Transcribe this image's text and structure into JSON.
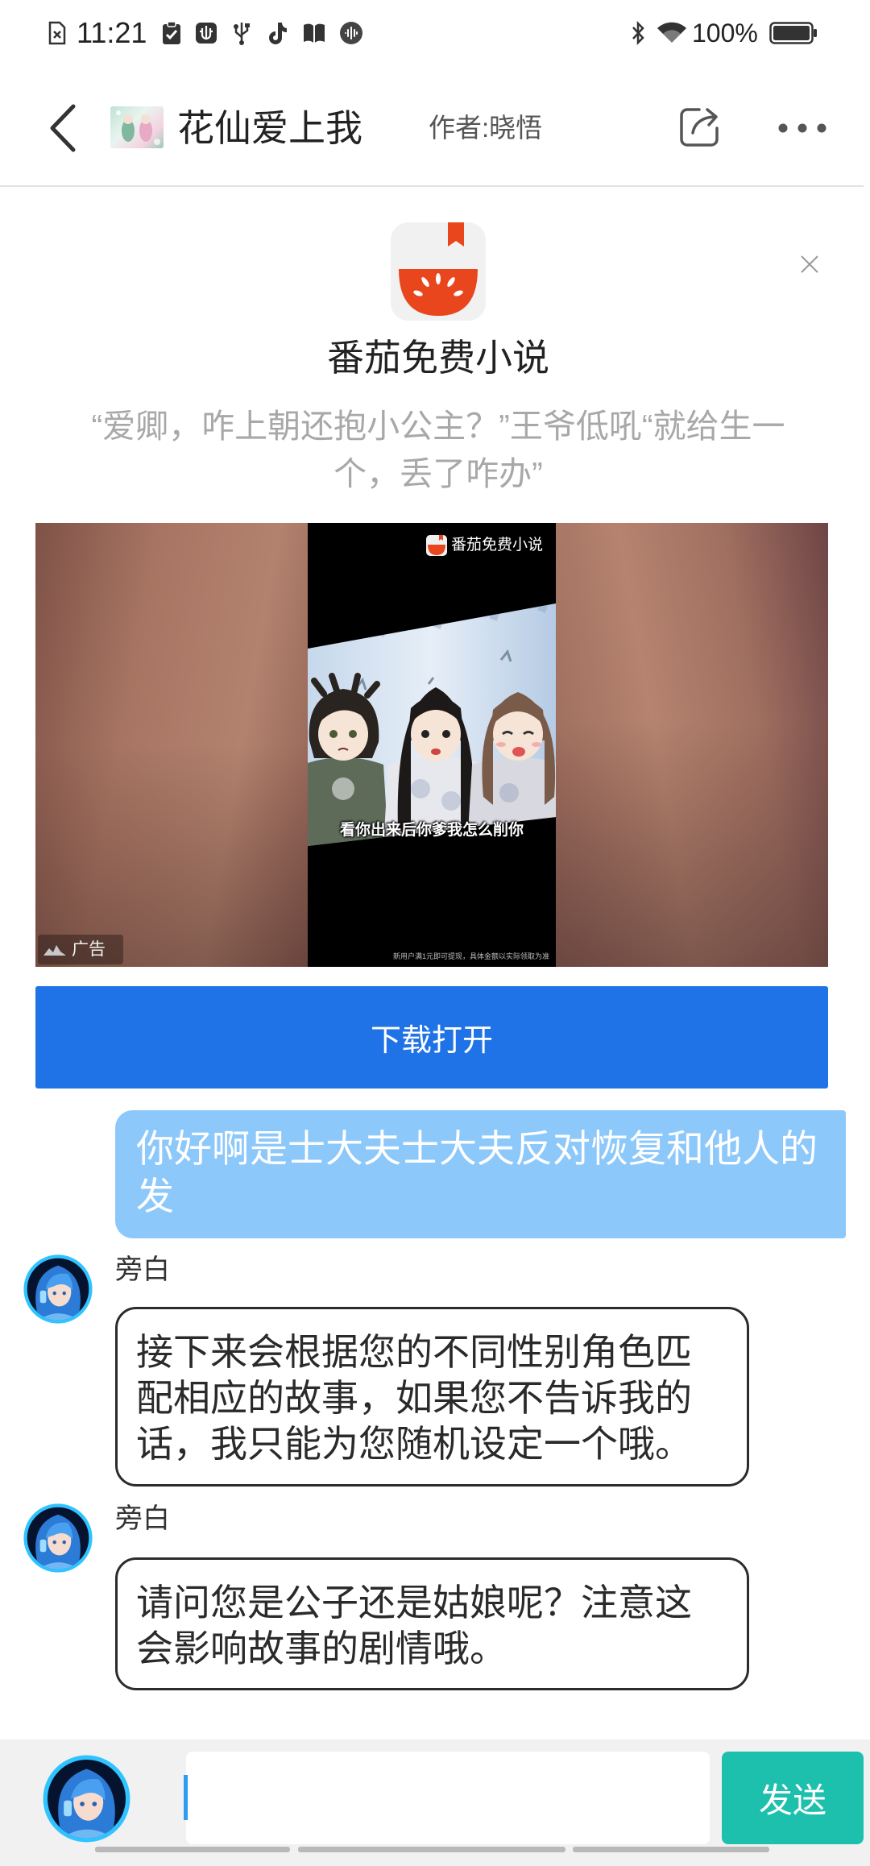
{
  "status_bar": {
    "time": "11:21",
    "battery": "100%",
    "left_icons": [
      "document-icon",
      "clipboard-check-icon",
      "usb-debugging-icon",
      "usb-icon",
      "tiktok-icon",
      "book-icon",
      "voice-assistant-icon"
    ],
    "right_icons": [
      "bluetooth-icon",
      "wifi-icon",
      "battery-icon"
    ]
  },
  "header": {
    "title": "花仙爱上我",
    "author": "作者:晓悟",
    "icons": [
      "back-icon",
      "share-icon",
      "more-icon"
    ]
  },
  "ad": {
    "app_name": "番茄免费小说",
    "quote_lines": [
      "“爱卿，咋上朝还抱小公主？”王爷低吼“就给生一",
      "个，丢了咋办”"
    ],
    "video": {
      "logo_text": "番茄免费小说",
      "caption": "看你出来后你爹我怎么削你",
      "disclaimer": "新用户满1元即可提现，具体金额以实际领取为准"
    },
    "tag": "广告",
    "download_label": "下载打开"
  },
  "messages": [
    {
      "role": "user",
      "lines": [
        "你好啊是士大夫士大夫反对恢复和他人的",
        "发"
      ]
    },
    {
      "role": "narrator",
      "name": "旁白",
      "lines": [
        "接下来会根据您的不同性别角色匹",
        "配相应的故事，如果您不告诉我的",
        "话，我只能为您随机设定一个哦。"
      ]
    },
    {
      "role": "narrator",
      "name": "旁白",
      "lines": [
        "请问您是公子还是姑娘呢？注意这",
        "会影响故事的剧情哦。"
      ]
    }
  ],
  "composer": {
    "input_value": "",
    "send_label": "发送"
  },
  "colors": {
    "download_button": "#1f73e6",
    "user_bubble": "#8dc8fb",
    "send_button": "#1dbfad",
    "brand_red": "#e9461d"
  }
}
